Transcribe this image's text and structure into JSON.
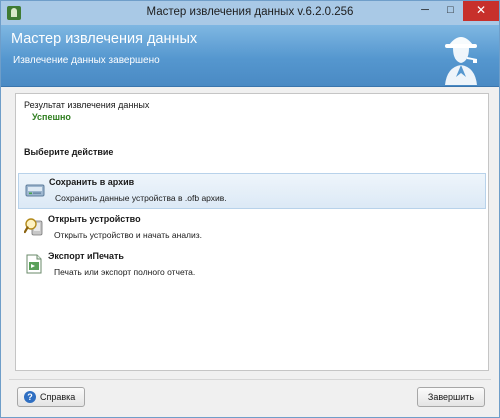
{
  "window": {
    "title": "Мастер извлечения данных v.6.2.0.256",
    "minimize": "─",
    "maximize": "□",
    "close": "✕"
  },
  "header": {
    "title": "Мастер извлечения данных",
    "subtitle": "Извлечение данных завершено",
    "icon": "detective-icon"
  },
  "result": {
    "label": "Результат извлечения  данных",
    "value": "Успешно",
    "value_color": "#2e7d1e"
  },
  "choose_action_label": "Выберите действие",
  "actions": [
    {
      "title": "Сохранить в архив",
      "description": "Сохранить данные устройства в  .ofb архив.",
      "icon": "archive-drive-icon",
      "selected": true
    },
    {
      "title": "Открыть устройство",
      "description": "Открыть устройство и начать анализ.",
      "icon": "magnifier-device-icon",
      "selected": false
    },
    {
      "title": "Экспорт иПечать",
      "description": "Печать или  экспорт полного отчета.",
      "icon": "export-document-icon",
      "selected": false
    }
  ],
  "footer": {
    "help_label": "Справка",
    "help_icon_glyph": "?",
    "finish_label": "Завершить"
  },
  "colors": {
    "header_blue": "#5597cf",
    "titlebar": "#a9c9e6",
    "close_red": "#c7302b",
    "selected_bg": "#dce9f6"
  }
}
